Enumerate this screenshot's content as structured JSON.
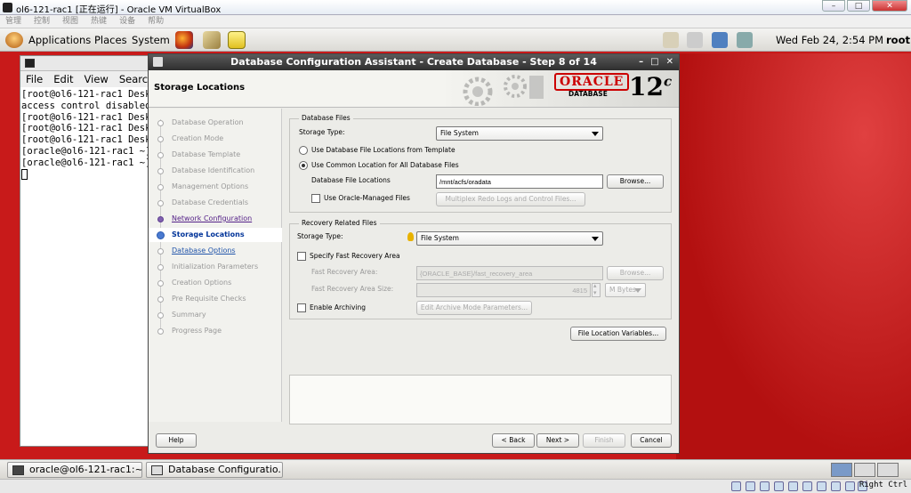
{
  "vbox": {
    "title": "ol6-121-rac1 [正在运行] - Oracle VM VirtualBox",
    "menu": [
      "管理",
      "控制",
      "视图",
      "热键",
      "设备",
      "帮助"
    ]
  },
  "panel": {
    "applications": "Applications",
    "places": "Places",
    "system": "System",
    "clock": "Wed Feb 24,  2:54 PM",
    "user": "root"
  },
  "terminal": {
    "menu": [
      "File",
      "Edit",
      "View",
      "Search"
    ],
    "lines": [
      "[root@ol6-121-rac1 Deskt",
      "access control disabled,",
      "[root@ol6-121-rac1 Deskt",
      "[root@ol6-121-rac1 Deskt",
      "[root@ol6-121-rac1 Deskt",
      "[oracle@ol6-121-rac1 ~]$",
      "[oracle@ol6-121-rac1 ~]$"
    ]
  },
  "dialog": {
    "title": "Database Configuration Assistant - Create Database - Step 8 of 14",
    "header_title": "Storage Locations",
    "brand": "ORACLE",
    "brand_sub": "DATABASE",
    "version": "12",
    "version_suffix": "c",
    "steps": [
      {
        "label": "Database Operation",
        "state": "pending"
      },
      {
        "label": "Creation Mode",
        "state": "pending"
      },
      {
        "label": "Database Template",
        "state": "pending"
      },
      {
        "label": "Database Identification",
        "state": "pending"
      },
      {
        "label": "Management Options",
        "state": "pending"
      },
      {
        "label": "Database Credentials",
        "state": "pending"
      },
      {
        "label": "Network Configuration",
        "state": "done"
      },
      {
        "label": "Storage Locations",
        "state": "current"
      },
      {
        "label": "Database Options",
        "state": "link"
      },
      {
        "label": "Initialization Parameters",
        "state": "pending"
      },
      {
        "label": "Creation Options",
        "state": "pending"
      },
      {
        "label": "Pre Requisite Checks",
        "state": "pending"
      },
      {
        "label": "Summary",
        "state": "pending"
      },
      {
        "label": "Progress Page",
        "state": "pending"
      }
    ],
    "db_files": {
      "group": "Database Files",
      "storage_type_label": "Storage Type:",
      "storage_type": "File System",
      "radio_template": "Use Database File Locations from Template",
      "radio_common": "Use Common Location for All Database Files",
      "file_loc_label": "Database File Locations",
      "file_loc_value": "/mnt/acfs/oradata",
      "browse": "Browse...",
      "omf": "Use Oracle-Managed Files",
      "multiplex": "Multiplex Redo Logs and Control Files..."
    },
    "recovery": {
      "group": "Recovery Related Files",
      "storage_type_label": "Storage Type:",
      "storage_type": "File System",
      "specify_fra": "Specify Fast Recovery Area",
      "fra_label": "Fast Recovery Area:",
      "fra_value": "{ORACLE_BASE}/fast_recovery_area",
      "browse": "Browse...",
      "fra_size_label": "Fast Recovery Area Size:",
      "fra_size": "4815",
      "fra_unit": "M Bytes",
      "archiving": "Enable Archiving",
      "edit_archive": "Edit Archive Mode Parameters..."
    },
    "file_loc_vars": "File Location Variables...",
    "buttons": {
      "help": "Help",
      "back": "< Back",
      "next": "Next >",
      "finish": "Finish",
      "cancel": "Cancel"
    }
  },
  "taskbar": {
    "tasks": [
      "oracle@ol6-121-rac1:~",
      "Database Configuratio..."
    ]
  },
  "statusbar": {
    "host_key": "Right Ctrl"
  }
}
